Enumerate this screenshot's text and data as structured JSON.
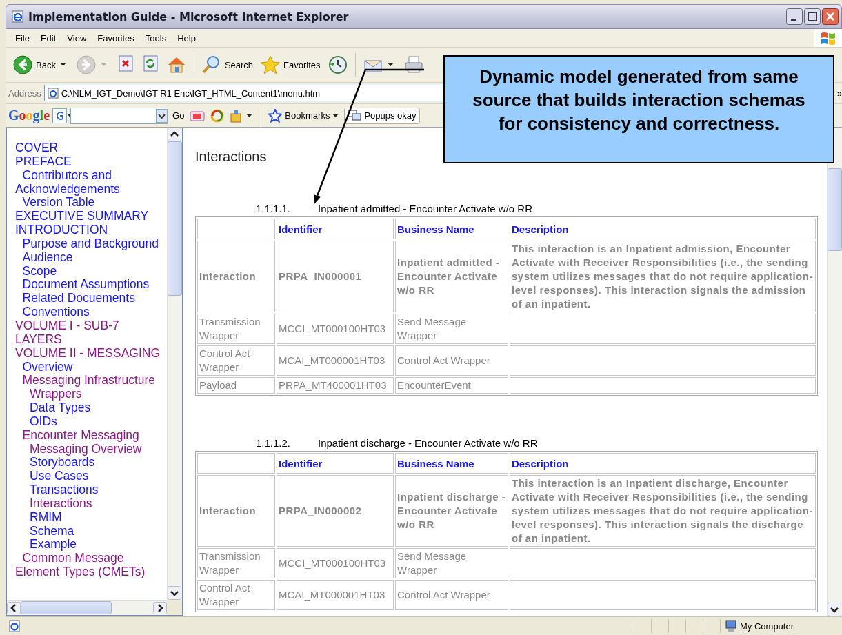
{
  "window": {
    "title": "Implementation Guide - Microsoft Internet Explorer"
  },
  "menu": [
    {
      "label": "File"
    },
    {
      "label": "Edit"
    },
    {
      "label": "View"
    },
    {
      "label": "Favorites"
    },
    {
      "label": "Tools"
    },
    {
      "label": "Help"
    }
  ],
  "toolbar": [
    {
      "kind": "back",
      "label": "Back",
      "dropdown": true,
      "disabled": false
    },
    {
      "kind": "forward",
      "dropdown": true,
      "disabled": true
    },
    {
      "kind": "stop",
      "dropdown": false,
      "disabled": false
    },
    {
      "kind": "refresh",
      "dropdown": false,
      "disabled": false
    },
    {
      "kind": "home",
      "dropdown": false,
      "disabled": false
    },
    {
      "kind": "search",
      "label": "Search",
      "dropdown": false,
      "disabled": false
    },
    {
      "kind": "favorites",
      "label": "Favorites",
      "dropdown": false,
      "disabled": false
    },
    {
      "kind": "history",
      "dropdown": false,
      "disabled": false
    },
    {
      "kind": "mail",
      "dropdown": true,
      "disabled": false
    },
    {
      "kind": "print",
      "dropdown": false,
      "disabled": false
    }
  ],
  "address": {
    "label": "Address",
    "value": "C:\\NLM_IGT_Demo\\IGT R1 Enc\\IGT_HTML_Content1\\menu.htm",
    "more": "»"
  },
  "google_toolbar": {
    "logo": "Google",
    "go": "Go",
    "bookmarks": "Bookmarks",
    "popups": "Popups okay"
  },
  "sidebar": {
    "items": [
      {
        "label": "COVER",
        "visited": false
      },
      {
        "label": "PREFACE",
        "visited": false,
        "children": [
          {
            "label": "Contributors and Acknowledgements",
            "visited": false
          },
          {
            "label": "Version Table",
            "visited": false
          }
        ]
      },
      {
        "label": "EXECUTIVE SUMMARY",
        "visited": false
      },
      {
        "label": "INTRODUCTION",
        "visited": false,
        "children": [
          {
            "label": "Purpose and Background",
            "visited": false
          },
          {
            "label": "Audience",
            "visited": false
          },
          {
            "label": "Scope",
            "visited": false
          },
          {
            "label": "Document Assumptions",
            "visited": false
          },
          {
            "label": "Related Docuements",
            "visited": false
          },
          {
            "label": "Conventions",
            "visited": false
          }
        ]
      },
      {
        "label": "VOLUME I - SUB-7 LAYERS",
        "visited": true
      },
      {
        "label": "VOLUME II - MESSAGING",
        "visited": true,
        "children": [
          {
            "label": "Overview",
            "visited": false
          },
          {
            "label": "Messaging Infrastructure",
            "visited": true,
            "children": [
              {
                "label": "Wrappers",
                "visited": true
              },
              {
                "label": "Data Types",
                "visited": false
              },
              {
                "label": "OIDs",
                "visited": false
              }
            ]
          },
          {
            "label": "Encounter Messaging",
            "visited": true,
            "children": [
              {
                "label": "Messaging Overview",
                "visited": true
              },
              {
                "label": "Storyboards",
                "visited": false
              },
              {
                "label": "Use Cases",
                "visited": false
              },
              {
                "label": "Transactions",
                "visited": false
              },
              {
                "label": "Interactions",
                "visited": true
              },
              {
                "label": "RMIM",
                "visited": false
              },
              {
                "label": "Schema",
                "visited": false
              },
              {
                "label": "Example",
                "visited": false
              }
            ]
          },
          {
            "label": "Common Message Element Types (CMETs)",
            "visited": true
          }
        ]
      }
    ]
  },
  "document": {
    "heading": "Interactions",
    "sections": [
      {
        "number": "1.1.1.1.",
        "title": "Inpatient admitted - Encounter Activate w/o RR",
        "columns": [
          "",
          "Identifier",
          "Business Name",
          "Description"
        ],
        "rows": [
          {
            "kind": "main",
            "cells": [
              "Interaction",
              "PRPA_IN000001",
              "Inpatient admitted - Encounter Activate w/o RR",
              "This interaction is an Inpatient admission, Encounter Activate with Receiver Responsibilities (i.e., the sending system utilizes messages that do not require application-level responses). This interaction signals the admission of an inpatient."
            ]
          },
          {
            "kind": "plain",
            "cells": [
              "Transmission Wrapper",
              "MCCI_MT000100HT03",
              "Send Message Wrapper"
            ]
          },
          {
            "kind": "plain",
            "cells": [
              "Control Act Wrapper",
              "MCAI_MT000001HT03",
              "Control Act Wrapper"
            ]
          },
          {
            "kind": "plain",
            "cells": [
              "Payload",
              "PRPA_MT400001HT03",
              "EncounterEvent"
            ]
          }
        ]
      },
      {
        "number": "1.1.1.2.",
        "title": "Inpatient discharge - Encounter Activate w/o RR",
        "columns": [
          "",
          "Identifier",
          "Business Name",
          "Description"
        ],
        "rows": [
          {
            "kind": "main",
            "cells": [
              "Interaction",
              "PRPA_IN000002",
              "Inpatient discharge - Encounter Activate w/o RR",
              "This interaction is an Inpatient discharge, Encounter Activate with Receiver Responsibilities (i.e., the sending system utilizes messages that do not require application-level responses). This interaction signals the discharge of an inpatient."
            ]
          },
          {
            "kind": "plain",
            "cells": [
              "Transmission Wrapper",
              "MCCI_MT000100HT03",
              "Send Message Wrapper"
            ]
          },
          {
            "kind": "plain",
            "cells": [
              "Control Act Wrapper",
              "MCAI_MT000001HT03",
              "Control Act Wrapper"
            ]
          }
        ]
      }
    ]
  },
  "callout": {
    "text": "Dynamic model generated from same source that builds interaction schemas for consistency and correctness."
  },
  "status_bar": {
    "zone": "My Computer"
  }
}
